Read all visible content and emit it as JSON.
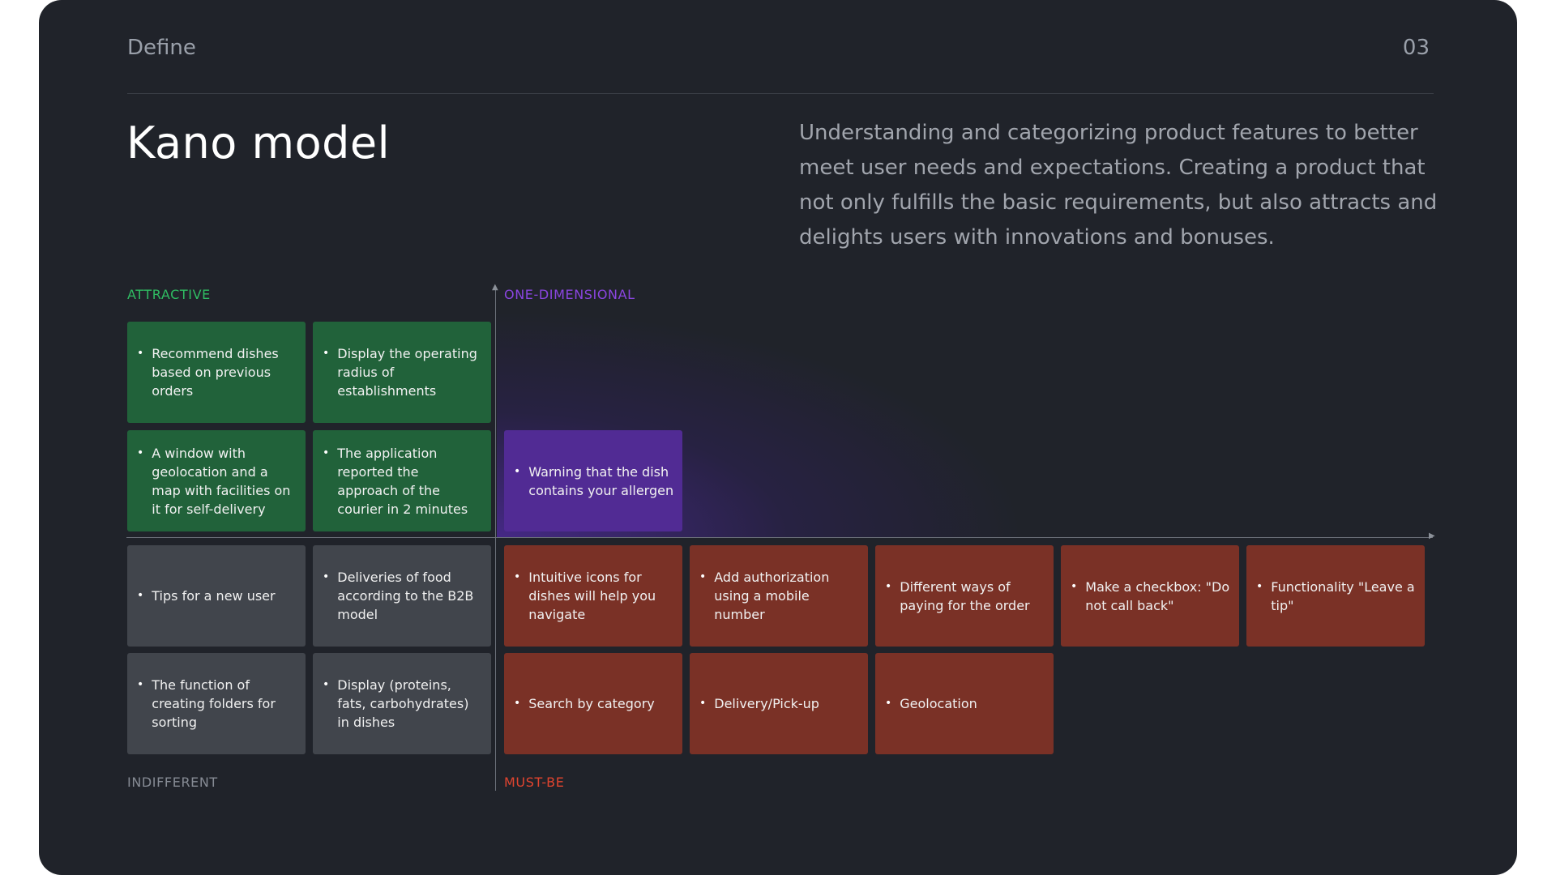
{
  "header": {
    "section": "Define",
    "page_number": "03"
  },
  "title": "Kano model",
  "description": "Understanding and categorizing product features to better meet user needs and expectations. Creating a product that not only fulfills the basic requirements, but also attracts and delights users with innovations and bonuses.",
  "quadrants": {
    "attractive": {
      "label": "ATTRACTIVE",
      "color": "#2fbc62",
      "items": [
        "Recommend dishes based on previous orders",
        "Display the operating radius of establishments",
        "A window with geolocation and a map with facilities on it for self-delivery",
        "The application reported the approach of the courier in 2 minutes"
      ]
    },
    "one_dimensional": {
      "label": "ONE-DIMENSIONAL",
      "color": "#8a45e0",
      "items": [
        "Warning that the dish contains your allergen"
      ]
    },
    "indifferent": {
      "label": "INDIFFERENT",
      "color": "#868b94",
      "items": [
        "Tips for a new user",
        "Deliveries of food according to the B2B model",
        "The function of creating folders for sorting",
        "Display (proteins, fats, carbohydrates) in dishes"
      ]
    },
    "must_be": {
      "label": "MUST-BE",
      "color": "#e0442f",
      "items": [
        "Intuitive icons for dishes will help you navigate",
        "Add authorization using a mobile number",
        "Different ways of paying for the order",
        "Make a checkbox: \"Do not call back\"",
        "Functionality \"Leave a tip\"",
        "Search by category",
        "Delivery/Pick-up",
        "Geolocation"
      ]
    }
  },
  "bullet_char": "•"
}
